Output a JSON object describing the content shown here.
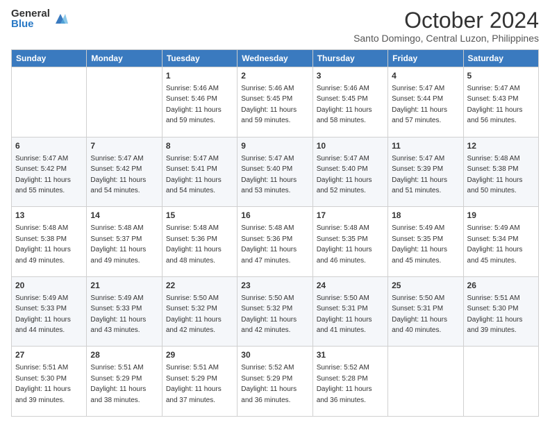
{
  "header": {
    "logo_general": "General",
    "logo_blue": "Blue",
    "month_title": "October 2024",
    "location": "Santo Domingo, Central Luzon, Philippines"
  },
  "days_of_week": [
    "Sunday",
    "Monday",
    "Tuesday",
    "Wednesday",
    "Thursday",
    "Friday",
    "Saturday"
  ],
  "weeks": [
    [
      {
        "day": "",
        "sunrise": "",
        "sunset": "",
        "daylight": ""
      },
      {
        "day": "",
        "sunrise": "",
        "sunset": "",
        "daylight": ""
      },
      {
        "day": "1",
        "sunrise": "Sunrise: 5:46 AM",
        "sunset": "Sunset: 5:46 PM",
        "daylight": "Daylight: 11 hours and 59 minutes."
      },
      {
        "day": "2",
        "sunrise": "Sunrise: 5:46 AM",
        "sunset": "Sunset: 5:45 PM",
        "daylight": "Daylight: 11 hours and 59 minutes."
      },
      {
        "day": "3",
        "sunrise": "Sunrise: 5:46 AM",
        "sunset": "Sunset: 5:45 PM",
        "daylight": "Daylight: 11 hours and 58 minutes."
      },
      {
        "day": "4",
        "sunrise": "Sunrise: 5:47 AM",
        "sunset": "Sunset: 5:44 PM",
        "daylight": "Daylight: 11 hours and 57 minutes."
      },
      {
        "day": "5",
        "sunrise": "Sunrise: 5:47 AM",
        "sunset": "Sunset: 5:43 PM",
        "daylight": "Daylight: 11 hours and 56 minutes."
      }
    ],
    [
      {
        "day": "6",
        "sunrise": "Sunrise: 5:47 AM",
        "sunset": "Sunset: 5:42 PM",
        "daylight": "Daylight: 11 hours and 55 minutes."
      },
      {
        "day": "7",
        "sunrise": "Sunrise: 5:47 AM",
        "sunset": "Sunset: 5:42 PM",
        "daylight": "Daylight: 11 hours and 54 minutes."
      },
      {
        "day": "8",
        "sunrise": "Sunrise: 5:47 AM",
        "sunset": "Sunset: 5:41 PM",
        "daylight": "Daylight: 11 hours and 54 minutes."
      },
      {
        "day": "9",
        "sunrise": "Sunrise: 5:47 AM",
        "sunset": "Sunset: 5:40 PM",
        "daylight": "Daylight: 11 hours and 53 minutes."
      },
      {
        "day": "10",
        "sunrise": "Sunrise: 5:47 AM",
        "sunset": "Sunset: 5:40 PM",
        "daylight": "Daylight: 11 hours and 52 minutes."
      },
      {
        "day": "11",
        "sunrise": "Sunrise: 5:47 AM",
        "sunset": "Sunset: 5:39 PM",
        "daylight": "Daylight: 11 hours and 51 minutes."
      },
      {
        "day": "12",
        "sunrise": "Sunrise: 5:48 AM",
        "sunset": "Sunset: 5:38 PM",
        "daylight": "Daylight: 11 hours and 50 minutes."
      }
    ],
    [
      {
        "day": "13",
        "sunrise": "Sunrise: 5:48 AM",
        "sunset": "Sunset: 5:38 PM",
        "daylight": "Daylight: 11 hours and 49 minutes."
      },
      {
        "day": "14",
        "sunrise": "Sunrise: 5:48 AM",
        "sunset": "Sunset: 5:37 PM",
        "daylight": "Daylight: 11 hours and 49 minutes."
      },
      {
        "day": "15",
        "sunrise": "Sunrise: 5:48 AM",
        "sunset": "Sunset: 5:36 PM",
        "daylight": "Daylight: 11 hours and 48 minutes."
      },
      {
        "day": "16",
        "sunrise": "Sunrise: 5:48 AM",
        "sunset": "Sunset: 5:36 PM",
        "daylight": "Daylight: 11 hours and 47 minutes."
      },
      {
        "day": "17",
        "sunrise": "Sunrise: 5:48 AM",
        "sunset": "Sunset: 5:35 PM",
        "daylight": "Daylight: 11 hours and 46 minutes."
      },
      {
        "day": "18",
        "sunrise": "Sunrise: 5:49 AM",
        "sunset": "Sunset: 5:35 PM",
        "daylight": "Daylight: 11 hours and 45 minutes."
      },
      {
        "day": "19",
        "sunrise": "Sunrise: 5:49 AM",
        "sunset": "Sunset: 5:34 PM",
        "daylight": "Daylight: 11 hours and 45 minutes."
      }
    ],
    [
      {
        "day": "20",
        "sunrise": "Sunrise: 5:49 AM",
        "sunset": "Sunset: 5:33 PM",
        "daylight": "Daylight: 11 hours and 44 minutes."
      },
      {
        "day": "21",
        "sunrise": "Sunrise: 5:49 AM",
        "sunset": "Sunset: 5:33 PM",
        "daylight": "Daylight: 11 hours and 43 minutes."
      },
      {
        "day": "22",
        "sunrise": "Sunrise: 5:50 AM",
        "sunset": "Sunset: 5:32 PM",
        "daylight": "Daylight: 11 hours and 42 minutes."
      },
      {
        "day": "23",
        "sunrise": "Sunrise: 5:50 AM",
        "sunset": "Sunset: 5:32 PM",
        "daylight": "Daylight: 11 hours and 42 minutes."
      },
      {
        "day": "24",
        "sunrise": "Sunrise: 5:50 AM",
        "sunset": "Sunset: 5:31 PM",
        "daylight": "Daylight: 11 hours and 41 minutes."
      },
      {
        "day": "25",
        "sunrise": "Sunrise: 5:50 AM",
        "sunset": "Sunset: 5:31 PM",
        "daylight": "Daylight: 11 hours and 40 minutes."
      },
      {
        "day": "26",
        "sunrise": "Sunrise: 5:51 AM",
        "sunset": "Sunset: 5:30 PM",
        "daylight": "Daylight: 11 hours and 39 minutes."
      }
    ],
    [
      {
        "day": "27",
        "sunrise": "Sunrise: 5:51 AM",
        "sunset": "Sunset: 5:30 PM",
        "daylight": "Daylight: 11 hours and 39 minutes."
      },
      {
        "day": "28",
        "sunrise": "Sunrise: 5:51 AM",
        "sunset": "Sunset: 5:29 PM",
        "daylight": "Daylight: 11 hours and 38 minutes."
      },
      {
        "day": "29",
        "sunrise": "Sunrise: 5:51 AM",
        "sunset": "Sunset: 5:29 PM",
        "daylight": "Daylight: 11 hours and 37 minutes."
      },
      {
        "day": "30",
        "sunrise": "Sunrise: 5:52 AM",
        "sunset": "Sunset: 5:29 PM",
        "daylight": "Daylight: 11 hours and 36 minutes."
      },
      {
        "day": "31",
        "sunrise": "Sunrise: 5:52 AM",
        "sunset": "Sunset: 5:28 PM",
        "daylight": "Daylight: 11 hours and 36 minutes."
      },
      {
        "day": "",
        "sunrise": "",
        "sunset": "",
        "daylight": ""
      },
      {
        "day": "",
        "sunrise": "",
        "sunset": "",
        "daylight": ""
      }
    ]
  ]
}
